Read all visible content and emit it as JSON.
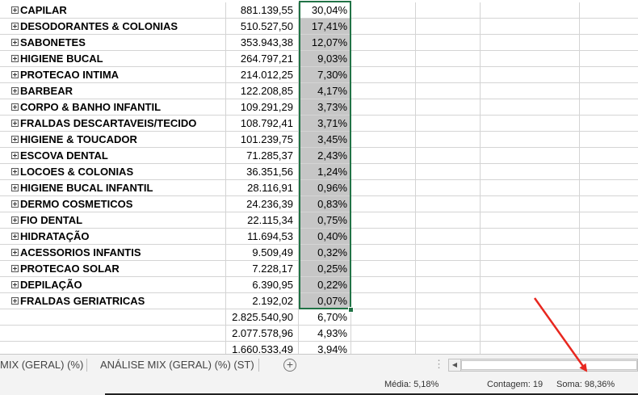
{
  "rows": [
    {
      "label": "CAPILAR",
      "value": "881.139,55",
      "pct": "30,04%"
    },
    {
      "label": "DESODORANTES & COLONIAS",
      "value": "510.527,50",
      "pct": "17,41%"
    },
    {
      "label": "SABONETES",
      "value": "353.943,38",
      "pct": "12,07%"
    },
    {
      "label": "HIGIENE BUCAL",
      "value": "264.797,21",
      "pct": "9,03%"
    },
    {
      "label": "PROTECAO INTIMA",
      "value": "214.012,25",
      "pct": "7,30%"
    },
    {
      "label": "BARBEAR",
      "value": "122.208,85",
      "pct": "4,17%"
    },
    {
      "label": "CORPO & BANHO INFANTIL",
      "value": "109.291,29",
      "pct": "3,73%"
    },
    {
      "label": "FRALDAS DESCARTAVEIS/TECIDO",
      "value": "108.792,41",
      "pct": "3,71%"
    },
    {
      "label": "HIGIENE & TOUCADOR",
      "value": "101.239,75",
      "pct": "3,45%"
    },
    {
      "label": "ESCOVA DENTAL",
      "value": "71.285,37",
      "pct": "2,43%"
    },
    {
      "label": "LOCOES & COLONIAS",
      "value": "36.351,56",
      "pct": "1,24%"
    },
    {
      "label": "HIGIENE BUCAL INFANTIL",
      "value": "28.116,91",
      "pct": "0,96%"
    },
    {
      "label": "DERMO COSMETICOS",
      "value": "24.236,39",
      "pct": "0,83%"
    },
    {
      "label": "FIO DENTAL",
      "value": "22.115,34",
      "pct": "0,75%"
    },
    {
      "label": " HIDRATAÇÃO",
      "value": "11.694,53",
      "pct": "0,40%"
    },
    {
      "label": "ACESSORIOS INFANTIS",
      "value": "9.509,49",
      "pct": "0,32%"
    },
    {
      "label": "PROTECAO SOLAR",
      "value": "7.228,17",
      "pct": "0,25%"
    },
    {
      "label": "DEPILAÇÃO",
      "value": "6.390,95",
      "pct": "0,22%"
    },
    {
      "label": "FRALDAS GERIATRICAS",
      "value": "2.192,02",
      "pct": "0,07%"
    }
  ],
  "extra_rows": [
    {
      "value": "2.825.540,90",
      "pct": "6,70%"
    },
    {
      "value": "2.077.578,96",
      "pct": "4,93%"
    },
    {
      "value": "1.660.533,49",
      "pct": "3,94%"
    }
  ],
  "tabs": {
    "tab1": "MIX (GERAL) (%)",
    "tab2": "ANÁLISE MIX (GERAL) (%) (ST)",
    "add": "+",
    "more": "⋮"
  },
  "status": {
    "media": "Média: 5,18%",
    "contagem": "Contagem: 19",
    "soma": "Soma: 98,36%"
  },
  "colors": {
    "selection_border": "#217346",
    "selection_fill": "#c6c6c6",
    "arrow": "#e8271f"
  }
}
